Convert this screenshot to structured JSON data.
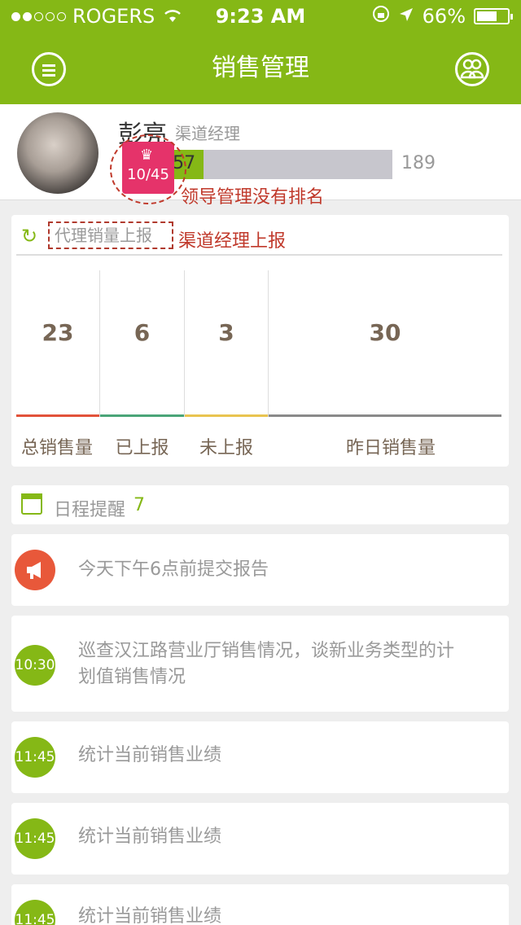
{
  "status": {
    "carrier": "ROGERS",
    "time": "9:23 AM",
    "battery": "66%",
    "battery_level": 0.66
  },
  "nav": {
    "title": "销售管理"
  },
  "profile": {
    "name": "彭亮",
    "role": "渠道经理",
    "progress_value": "57",
    "progress_total": "189",
    "rank": "10/45",
    "annotation": "领导管理没有排名"
  },
  "report": {
    "title": "代理销量上报",
    "annotation": "渠道经理上报",
    "stats": [
      {
        "value": "23",
        "label": "总销售量",
        "color": "#e2523a"
      },
      {
        "value": "6",
        "label": "已上报",
        "color": "#4aa578"
      },
      {
        "value": "3",
        "label": "未上报",
        "color": "#e9c450"
      },
      {
        "value": "30",
        "label": "昨日销售量",
        "color": "#8a8a8a"
      }
    ]
  },
  "schedule": {
    "title": "日程提醒",
    "count": "7",
    "items": [
      {
        "icon": "megaphone-icon",
        "time": "",
        "color": "#e8583a",
        "text": "今天下午6点前提交报告"
      },
      {
        "icon": "time-badge",
        "time": "10:30",
        "color": "#85b816",
        "text": "巡查汉江路营业厅销售情况，谈新业务类型的计划值销售情况"
      },
      {
        "icon": "time-badge",
        "time": "11:45",
        "color": "#85b816",
        "text": "统计当前销售业绩"
      },
      {
        "icon": "time-badge",
        "time": "11:45",
        "color": "#85b816",
        "text": "统计当前销售业绩"
      },
      {
        "icon": "time-badge",
        "time": "11:45",
        "color": "#85b816",
        "text": "统计当前销售业绩"
      }
    ]
  }
}
